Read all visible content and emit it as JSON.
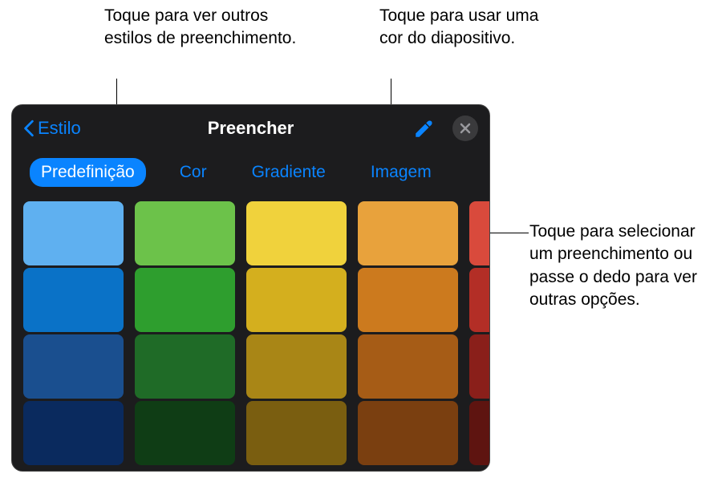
{
  "callouts": {
    "styles": "Toque para ver outros estilos de preenchimento.",
    "eyedropper": "Toque para usar uma cor do diapositivo.",
    "select": "Toque para selecionar um preenchimento ou passe o dedo para ver outras opções."
  },
  "panel": {
    "back_label": "Estilo",
    "title": "Preencher",
    "tabs": {
      "preset": "Predefinição",
      "color": "Cor",
      "gradient": "Gradiente",
      "image": "Imagem"
    }
  },
  "swatches": [
    [
      "#5fb0f0",
      "#0a72c7",
      "#1a4f8f",
      "#0a2a5e"
    ],
    [
      "#6cc24a",
      "#2e9e2e",
      "#1f6b27",
      "#0f3d15"
    ],
    [
      "#f0d23c",
      "#d4af1e",
      "#a98616",
      "#7a5e10"
    ],
    [
      "#e8a23c",
      "#cc7a1e",
      "#a65c16",
      "#7a3f10"
    ],
    [
      "#d94a3c",
      "#b32e26",
      "#8a1f1a",
      "#5e1410"
    ]
  ]
}
